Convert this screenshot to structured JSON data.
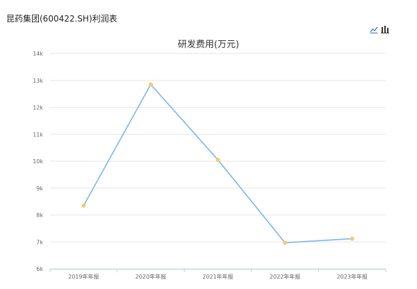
{
  "page": {
    "title": "昆药集团(600422.SH)利润表"
  },
  "toolbar": {
    "icons": [
      "line-chart-icon",
      "bar-chart-icon"
    ]
  },
  "colors": {
    "line": "#7cb5ec",
    "point": "#f9c96c",
    "grid": "#e6e6e6",
    "axis_text": "#666666"
  },
  "chart_data": {
    "type": "line",
    "title": "研发费用(万元)",
    "categories": [
      "2019年年报",
      "2020年年报",
      "2021年年报",
      "2022年年报",
      "2023年年报"
    ],
    "series": [
      {
        "values": [
          8350,
          12850,
          10050,
          6970,
          7120
        ]
      }
    ],
    "ylim": [
      6000,
      14000
    ],
    "yticks": [
      6000,
      7000,
      8000,
      9000,
      10000,
      11000,
      12000,
      13000,
      14000
    ],
    "ytick_labels": [
      "6k",
      "7k",
      "8k",
      "9k",
      "10k",
      "11k",
      "12k",
      "13k",
      "14k"
    ],
    "grid": true
  }
}
